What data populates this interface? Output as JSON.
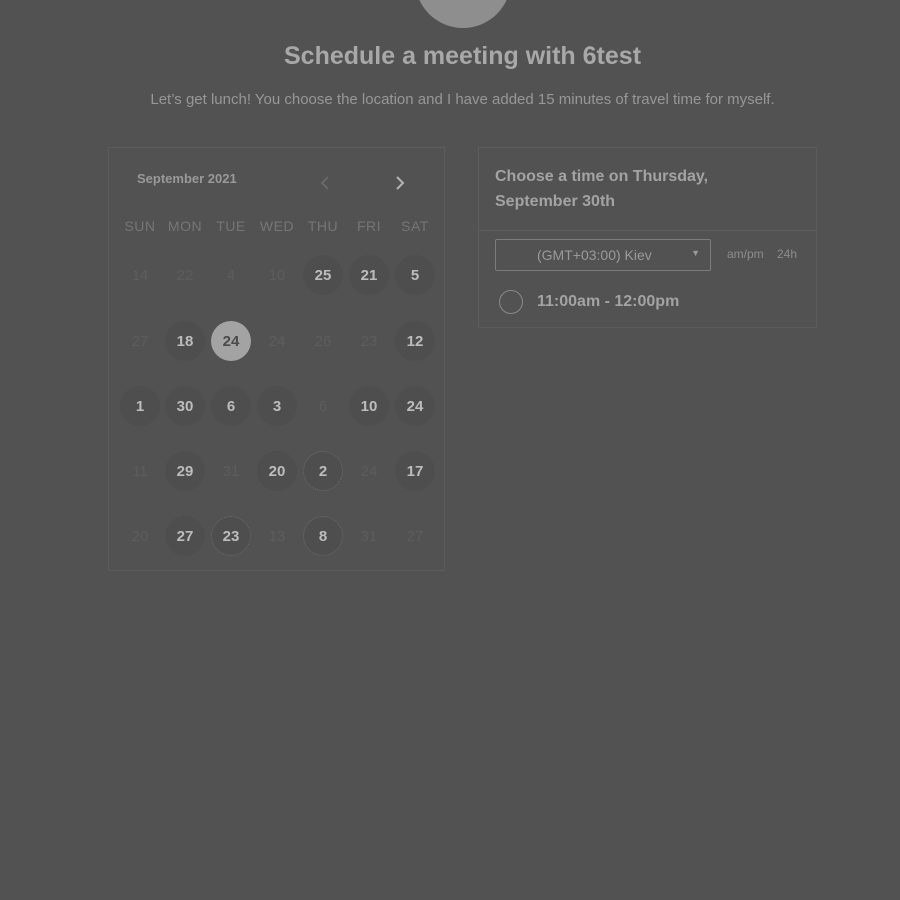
{
  "header": {
    "title": "Schedule a meeting with 6test",
    "subtitle": "Let’s get lunch! You choose the location and I have added 15 minutes of travel time for myself."
  },
  "calendar": {
    "month_label": "September 2021",
    "prev_icon": "chevron-left-icon",
    "next_icon": "chevron-right-icon",
    "weekdays": [
      "SUN",
      "MON",
      "TUE",
      "WED",
      "THU",
      "FRI",
      "SAT"
    ],
    "weeks": [
      [
        {
          "d": "14",
          "s": "off"
        },
        {
          "d": "22",
          "s": "off"
        },
        {
          "d": "4",
          "s": "off"
        },
        {
          "d": "10",
          "s": "off"
        },
        {
          "d": "25",
          "s": "on"
        },
        {
          "d": "21",
          "s": "on"
        },
        {
          "d": "5",
          "s": "on"
        }
      ],
      [
        {
          "d": "27",
          "s": "off"
        },
        {
          "d": "18",
          "s": "on"
        },
        {
          "d": "24",
          "s": "selected"
        },
        {
          "d": "24",
          "s": "off"
        },
        {
          "d": "26",
          "s": "off"
        },
        {
          "d": "23",
          "s": "off"
        },
        {
          "d": "12",
          "s": "on"
        }
      ],
      [
        {
          "d": "1",
          "s": "on"
        },
        {
          "d": "30",
          "s": "on"
        },
        {
          "d": "6",
          "s": "on"
        },
        {
          "d": "3",
          "s": "on"
        },
        {
          "d": "6",
          "s": "off"
        },
        {
          "d": "10",
          "s": "on"
        },
        {
          "d": "24",
          "s": "on"
        }
      ],
      [
        {
          "d": "11",
          "s": "off"
        },
        {
          "d": "29",
          "s": "on"
        },
        {
          "d": "31",
          "s": "off"
        },
        {
          "d": "20",
          "s": "on"
        },
        {
          "d": "2",
          "s": "on",
          "dot": true
        },
        {
          "d": "24",
          "s": "off"
        },
        {
          "d": "17",
          "s": "on"
        }
      ],
      [
        {
          "d": "20",
          "s": "off"
        },
        {
          "d": "27",
          "s": "on"
        },
        {
          "d": "23",
          "s": "on",
          "dot": true
        },
        {
          "d": "13",
          "s": "off"
        },
        {
          "d": "8",
          "s": "on",
          "dot": true
        },
        {
          "d": "31",
          "s": "off"
        },
        {
          "d": "27",
          "s": "off"
        }
      ]
    ]
  },
  "times": {
    "heading": "Choose a time on Thursday, September 30th",
    "timezone_value": "(GMT+03:00) Kiev",
    "dropdown_icon": "caret-down-icon",
    "format_12h": "am/pm",
    "format_24h": "24h",
    "slots": [
      {
        "label": "11:00am - 12:00pm"
      }
    ]
  }
}
